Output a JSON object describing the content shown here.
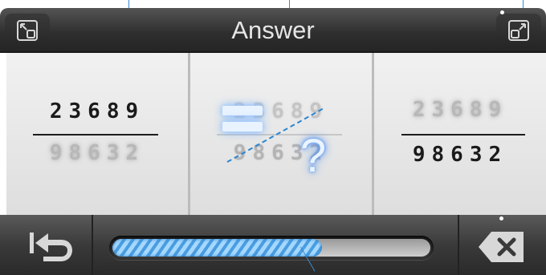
{
  "header": {
    "title": "Answer",
    "left_button_icon": "shrink-window-icon",
    "right_button_icon": "expand-window-icon"
  },
  "panels": [
    {
      "top_number": "23689",
      "bottom_number": "98632",
      "top_style": "sharp",
      "bottom_style": "blurred"
    },
    {
      "top_number": "23689",
      "bottom_number": "98632",
      "top_style": "faded",
      "bottom_style": "faded",
      "overlay_equals": "=",
      "overlay_question": "?"
    },
    {
      "top_number": "23689",
      "bottom_number": "98632",
      "top_style": "blurred",
      "bottom_style": "sharp"
    }
  ],
  "footer": {
    "back_icon": "back-arrow-icon",
    "delete_icon": "backspace-icon",
    "progress_fraction": 0.66
  },
  "colors": {
    "accent": "#3a8ad0",
    "progress": "#4a9de0",
    "bar_dark": "#2a2a2a"
  }
}
